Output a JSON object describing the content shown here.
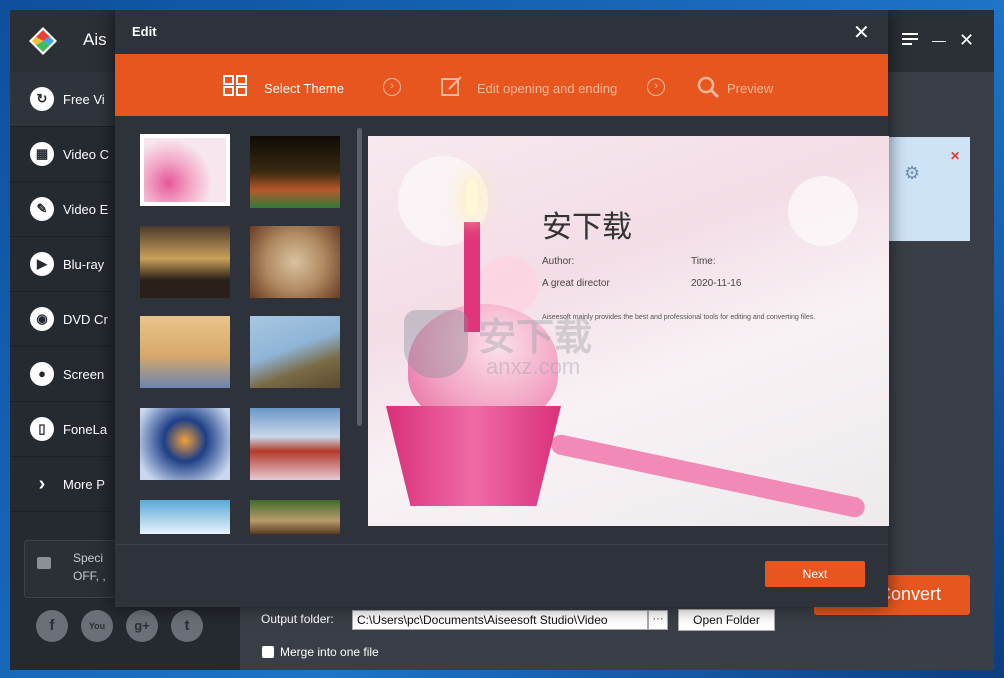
{
  "app": {
    "title": "Ais",
    "menu_icon": "menu-icon",
    "minimize_symbol": "—",
    "close_symbol": "✕"
  },
  "sidebar": {
    "items": [
      {
        "label": "Free Vi",
        "icon": "convert-icon",
        "symbol": "↻"
      },
      {
        "label": "Video C",
        "icon": "film-icon",
        "symbol": "▦"
      },
      {
        "label": "Video E",
        "icon": "palette-icon",
        "symbol": "✎"
      },
      {
        "label": "Blu-ray",
        "icon": "play-icon",
        "symbol": "▶"
      },
      {
        "label": "DVD Cr",
        "icon": "disc-icon",
        "symbol": "◉"
      },
      {
        "label": "Screen",
        "icon": "camera-icon",
        "symbol": "●"
      },
      {
        "label": "FoneLa",
        "icon": "phone-icon",
        "symbol": "▯"
      },
      {
        "label": "More P",
        "icon": "chevron-right-icon",
        "symbol": "›"
      }
    ],
    "special": {
      "line1": "Speci",
      "line2": "OFF, ,"
    },
    "social": [
      {
        "name": "facebook-icon",
        "symbol": "f"
      },
      {
        "name": "youtube-icon",
        "symbol": "You"
      },
      {
        "name": "googleplus-icon",
        "symbol": "g+"
      },
      {
        "name": "twitter-icon",
        "symbol": "t"
      }
    ]
  },
  "main": {
    "convert_label": "Convert",
    "output_folder_label": "Output folder:",
    "output_folder_value": "C:\\Users\\pc\\Documents\\Aiseesoft Studio\\Video",
    "more_label": "···",
    "open_folder_label": "Open Folder",
    "merge_label": "Merge into one file",
    "task_close": "✕",
    "task_gear": "⚙"
  },
  "dialog": {
    "title": "Edit",
    "close_symbol": "✕",
    "steps": [
      {
        "label": "Select Theme",
        "icon": "theme-grid-icon",
        "active": true
      },
      {
        "label": "Edit opening and ending",
        "icon": "edit-icon",
        "active": false
      },
      {
        "label": "Preview",
        "icon": "search-icon",
        "active": false
      }
    ],
    "step_separator": "›",
    "next_label": "Next",
    "themes": [
      {
        "name": "birthday-cupcake",
        "selected": true,
        "colors": [
          "#f5d6e3",
          "#e7579a"
        ]
      },
      {
        "name": "birthday-cake-candles",
        "selected": false,
        "colors": [
          "#1a1208",
          "#d8a532"
        ]
      },
      {
        "name": "family-sunset",
        "selected": false,
        "colors": [
          "#3a2e22",
          "#c9a05a"
        ]
      },
      {
        "name": "christmas-frame",
        "selected": false,
        "colors": [
          "#8a5a3a",
          "#d9c2a0"
        ]
      },
      {
        "name": "eiffel-tower",
        "selected": false,
        "colors": [
          "#e9c48a",
          "#6a86b0"
        ]
      },
      {
        "name": "motocross",
        "selected": false,
        "colors": [
          "#8fb4d6",
          "#7a6a45"
        ]
      },
      {
        "name": "winter-cabin",
        "selected": false,
        "colors": [
          "#1e3f86",
          "#f2a03a"
        ]
      },
      {
        "name": "mount-fuji-pagoda",
        "selected": false,
        "colors": [
          "#6c97c9",
          "#b33a2a"
        ]
      },
      {
        "name": "sky-clouds",
        "selected": false,
        "colors": [
          "#9cc8e6",
          "#e8f3fb"
        ]
      },
      {
        "name": "horse-racing",
        "selected": false,
        "colors": [
          "#3f6b2e",
          "#b89b6a"
        ]
      }
    ],
    "preview": {
      "title": "安下载",
      "author_label": "Author:",
      "author_value": "A great director",
      "time_label": "Time:",
      "time_value": "2020-11-16",
      "description": "Aiseesoft mainly provides the best and professional tools for editing and converting files.",
      "watermark_cn": "安下载",
      "watermark_en": "anxz.com"
    }
  }
}
